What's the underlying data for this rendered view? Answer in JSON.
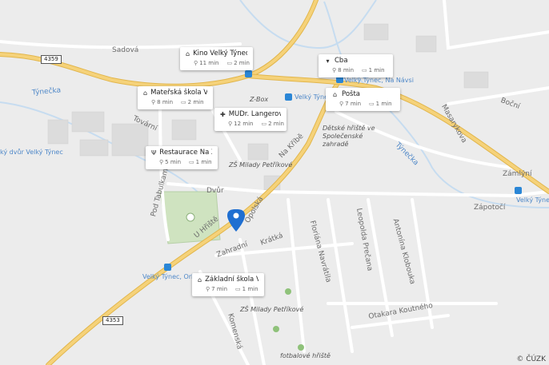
{
  "map": {
    "streets": [
      "Sadová",
      "Týnečka",
      "Tovární",
      "Dvůr",
      "Pod Tabulkami",
      "U Hřiště",
      "Zahradní",
      "Krátká",
      "Na Kříbě",
      "Floriána Navrátila",
      "Leopolda Prečana",
      "Antonína Klobouka",
      "Otakara Koutného",
      "Komenská",
      "Masarykova",
      "Boční",
      "Týnečka",
      "Zámlýní",
      "Zápotočí",
      "Opolská"
    ],
    "places": [
      "Velký Týnec",
      "Velký Týnec, Na Návsi",
      "Velký Týnec",
      "Velký Týnec, Orlovna",
      "ký dvůr Velký Týnec"
    ],
    "pois": [
      "Dětské hřiště ve Společenské zahradě",
      "ZŠ Milady Petříkové",
      "ZŠ Milady Petříkové",
      "fotbalové hřiště",
      "Z-Box"
    ],
    "road_numbers": [
      "4359",
      "4353"
    ],
    "attribution": "© ČÚZK"
  },
  "cards": [
    {
      "icon": "museum-icon",
      "title": "Kino Velký Týnec",
      "walk": "11 min",
      "car": "2 min"
    },
    {
      "icon": "cart-icon",
      "title": "Cba",
      "walk": "8 min",
      "car": "1 min"
    },
    {
      "icon": "school-icon",
      "title": "Mateřská škola V...",
      "walk": "8 min",
      "car": "2 min"
    },
    {
      "icon": "museum-icon",
      "title": "Pošta",
      "walk": "7 min",
      "car": "1 min"
    },
    {
      "icon": "clinic-icon",
      "title": "MUDr. Langerová ...",
      "walk": "12 min",
      "car": "2 min"
    },
    {
      "icon": "restaurant-icon",
      "title": "Restaurace Na Z...",
      "walk": "5 min",
      "car": "1 min"
    },
    {
      "icon": "school-icon",
      "title": "Základní škola Ve...",
      "walk": "7 min",
      "car": "1 min"
    }
  ],
  "colors": {
    "main_road": "#f5d27a",
    "main_road_edge": "#e2b64c",
    "pin": "#1f6fd1",
    "water": "#c6dcf0",
    "park": "#cfe3c0"
  }
}
